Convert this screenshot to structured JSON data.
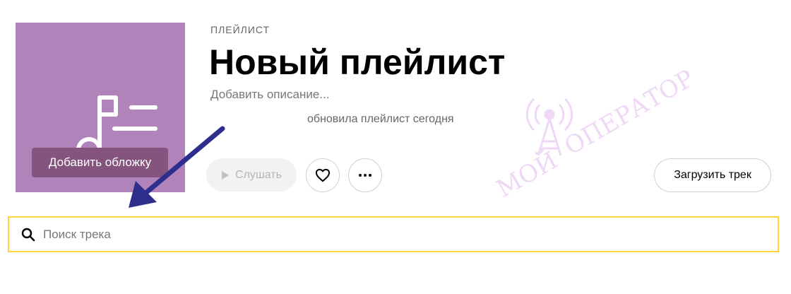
{
  "playlist": {
    "type_label": "ПЛЕЙЛИСТ",
    "title": "Новый плейлист",
    "description_placeholder": "Добавить описание...",
    "updated_text": "обновила плейлист сегодня",
    "cover_button": "Добавить обложку",
    "cover_color": "#b084ba"
  },
  "actions": {
    "listen_label": "Слушать",
    "upload_label": "Загрузить трек",
    "like_icon": "heart-icon",
    "more_icon": "more-dots-icon"
  },
  "search": {
    "placeholder": "Поиск трека",
    "border_color": "#ffd43b"
  },
  "watermark": {
    "text_left": "МОЙ",
    "text_right": "ОПЕРАТОР"
  },
  "annotation": {
    "arrow_color": "#2e2f8c"
  }
}
